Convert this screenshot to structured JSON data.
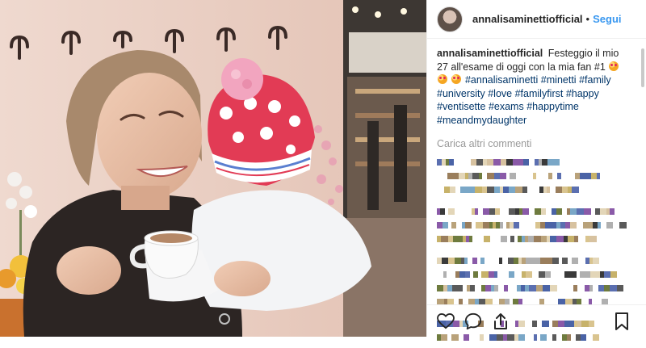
{
  "header": {
    "username": "annalisaminettiofficial",
    "separator": "•",
    "follow_label": "Segui"
  },
  "caption": {
    "username": "annalisaminettiofficial",
    "text_before": "Festeggio il mio 27 all'esame di oggi con la mia fan #1",
    "hashtags": [
      "#annalisaminetti",
      "#minetti",
      "#family",
      "#university",
      "#love",
      "#familyfirst",
      "#happy",
      "#ventisette",
      "#exams",
      "#happytime",
      "#meandmydaughter"
    ]
  },
  "load_more_label": "Carica altri commenti",
  "icons": {
    "like": "heart-icon",
    "comment": "comment-icon",
    "share": "share-icon",
    "save": "bookmark-icon"
  },
  "colors": {
    "link": "#003569",
    "follow": "#3897f0",
    "muted": "#999999",
    "text": "#262626"
  }
}
